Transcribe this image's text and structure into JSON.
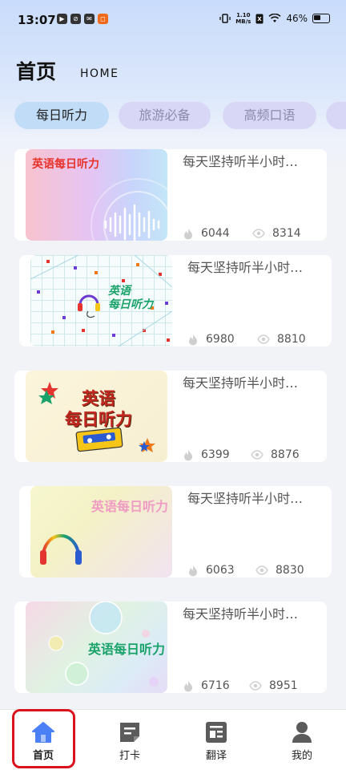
{
  "status_bar": {
    "time": "13:07",
    "apps": [
      "▶",
      "⊘",
      "✉",
      "◻"
    ],
    "network_speed_value": "1.10",
    "network_speed_unit": "MB/s",
    "battery": "46%"
  },
  "header": {
    "title": "首页",
    "subtitle": "HOME"
  },
  "tabs": [
    {
      "label": "每日听力",
      "active": true
    },
    {
      "label": "旅游必备",
      "active": false
    },
    {
      "label": "高频口语",
      "active": false
    }
  ],
  "cards": [
    {
      "thumb_text": "英语每日听力",
      "title": "每天坚持听半小时…",
      "likes": "6044",
      "views": "8314"
    },
    {
      "thumb_text_line1": "英语",
      "thumb_text_line2": "每日听力",
      "title": "每天坚持听半小时…",
      "likes": "6980",
      "views": "8810"
    },
    {
      "thumb_text_line1": "英语",
      "thumb_text_line2": "每日听力",
      "title": "每天坚持听半小时…",
      "likes": "6399",
      "views": "8876"
    },
    {
      "thumb_text": "英语每日听力",
      "title": "每天坚持听半小时…",
      "likes": "6063",
      "views": "8830"
    },
    {
      "thumb_text": "英语每日听力",
      "title": "每天坚持听半小时…",
      "likes": "6716",
      "views": "8951"
    }
  ],
  "bottom_nav": [
    {
      "label": "首页",
      "icon": "home-icon",
      "active": true
    },
    {
      "label": "打卡",
      "icon": "checkin-icon",
      "active": false
    },
    {
      "label": "翻译",
      "icon": "translate-icon",
      "active": false
    },
    {
      "label": "我的",
      "icon": "profile-icon",
      "active": false
    }
  ],
  "colors": {
    "accent": "#4a7ff5",
    "highlight": "#d9141e",
    "active_tab": "#c1dcf7",
    "inactive_tab": "#d8d7f5"
  }
}
